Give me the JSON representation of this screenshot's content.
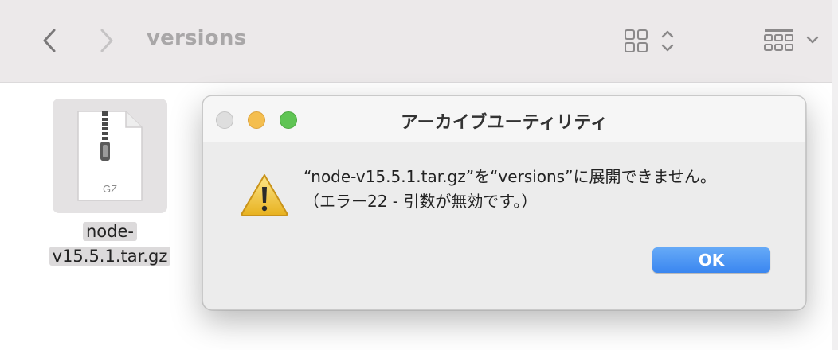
{
  "finder": {
    "title": "versions",
    "back_icon": "chevron-left-icon",
    "forward_icon": "chevron-right-icon",
    "view_icon": "grid-view-icon",
    "group_icon": "list-group-icon"
  },
  "file": {
    "badge": "GZ",
    "name_line1": "node-",
    "name_line2": "v15.5.1.tar.gz"
  },
  "dialog": {
    "title": "アーカイブユーティリティ",
    "message_line1": "“node-v15.5.1.tar.gz”を“versions”に展開できません。",
    "message_line2": "（エラー22 - 引数が無効です。）",
    "ok_label": "OK",
    "icon": "warning-icon"
  },
  "colors": {
    "accent": "#3a86f0",
    "close": "#dedede",
    "minimize": "#f4be4f",
    "zoom": "#5fc454"
  }
}
